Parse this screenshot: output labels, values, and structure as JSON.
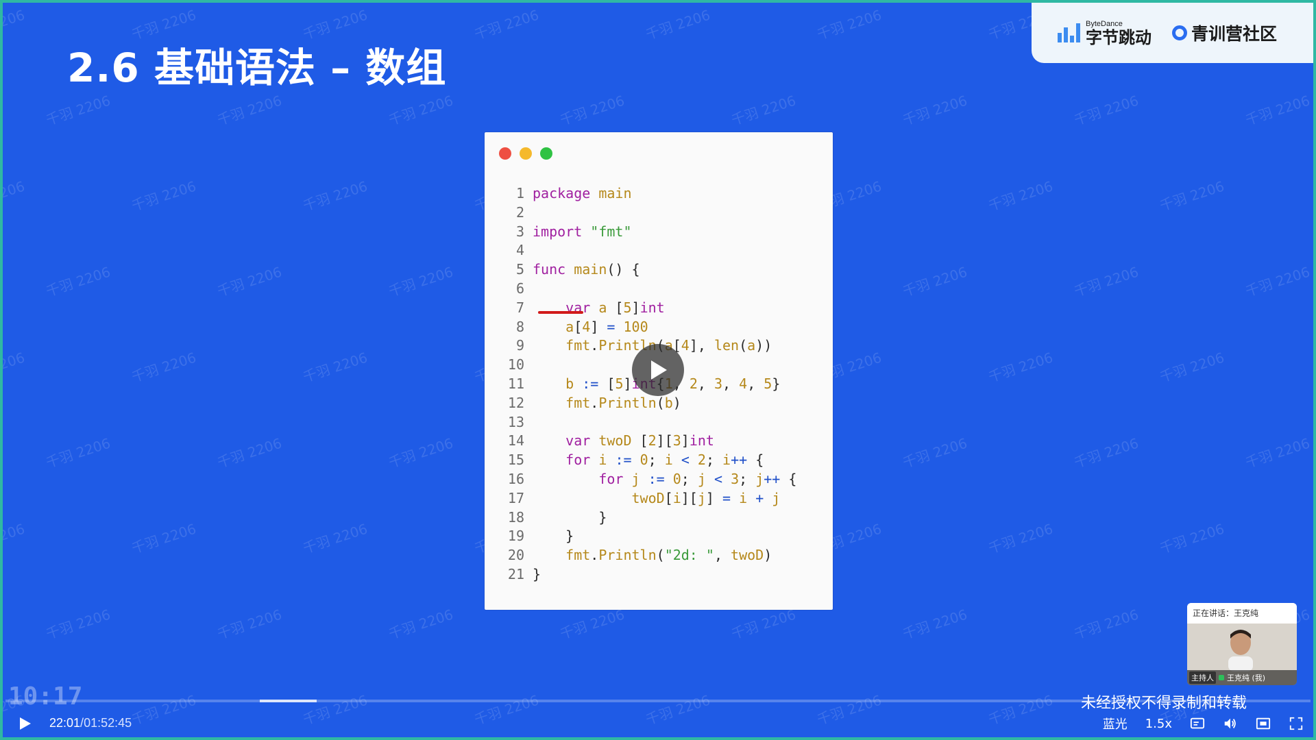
{
  "slide": {
    "title": "2.6 基础语法 – 数组"
  },
  "brand": {
    "bytedance_small": "ByteDance",
    "bytedance_large": "字节跳动",
    "community": "青训营社区"
  },
  "watermark_text": "千羽 2206",
  "code_window": {
    "lines": [
      {
        "n": "1"
      },
      {
        "n": "2"
      },
      {
        "n": "3"
      },
      {
        "n": "4"
      },
      {
        "n": "5"
      },
      {
        "n": "6"
      },
      {
        "n": "7"
      },
      {
        "n": "8"
      },
      {
        "n": "9"
      },
      {
        "n": "10"
      },
      {
        "n": "11"
      },
      {
        "n": "12"
      },
      {
        "n": "13"
      },
      {
        "n": "14"
      },
      {
        "n": "15"
      },
      {
        "n": "16"
      },
      {
        "n": "17"
      },
      {
        "n": "18"
      },
      {
        "n": "19"
      },
      {
        "n": "20"
      },
      {
        "n": "21"
      }
    ],
    "code": [
      "package main",
      "",
      "import \"fmt\"",
      "",
      "func main() {",
      "",
      "    var a [5]int",
      "    a[4] = 100",
      "    fmt.Println(a[4], len(a))",
      "",
      "    b := [5]int{1, 2, 3, 4, 5}",
      "    fmt.Println(b)",
      "",
      "    var twoD [2][3]int",
      "    for i := 0; i < 2; i++ {",
      "        for j := 0; j < 3; j++ {",
      "            twoD[i][j] = i + j",
      "        }",
      "    }",
      "    fmt.Println(\"2d: \", twoD)",
      "}"
    ]
  },
  "webcam": {
    "speaking": "正在讲话：王克纯",
    "host_badge": "主持人",
    "name": "王克纯 (我)"
  },
  "player": {
    "big_clock": "10:17",
    "current_time": "22:01",
    "separator": "/",
    "total_time": "01:52:45",
    "progress": 0.195,
    "copyright_notice": "未经授权不得录制和转载",
    "quality": "蓝光",
    "speed": "1.5x"
  },
  "colors": {
    "background": "#1f5be6",
    "traffic_red": "#ee4f42",
    "traffic_yellow": "#f5b92c",
    "traffic_green": "#2fc243",
    "annotation": "#d11a1a"
  }
}
